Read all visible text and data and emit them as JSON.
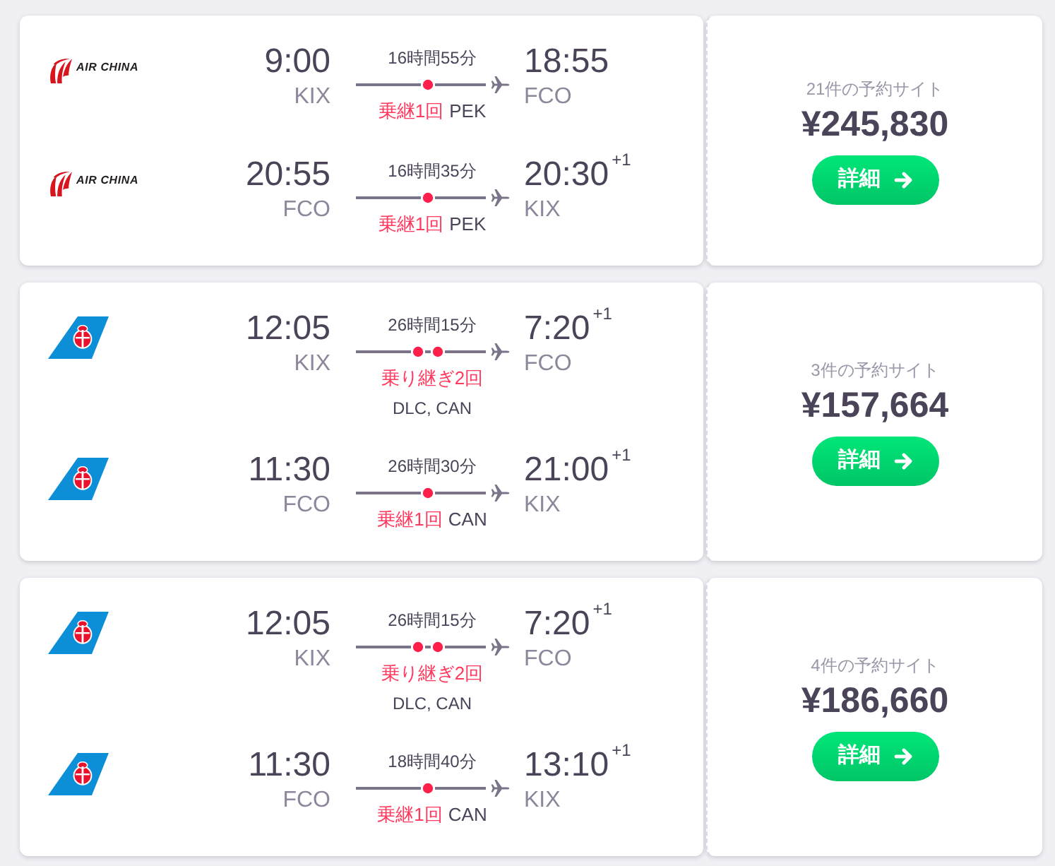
{
  "itineraries": [
    {
      "legs": [
        {
          "airline": {
            "kind": "wordmark",
            "logo_text": "AIR CHINA"
          },
          "departure": {
            "time": "9:00",
            "airport": "KIX"
          },
          "duration": "16時間55分",
          "kind": "one-stop",
          "stop_label": "乗継1回",
          "via": "PEK",
          "arrival": {
            "time": "18:55",
            "airport": "FCO"
          }
        },
        {
          "airline": {
            "kind": "wordmark",
            "logo_text": "AIR CHINA"
          },
          "departure": {
            "time": "20:55",
            "airport": "FCO"
          },
          "duration": "16時間35分",
          "kind": "one-stop",
          "stop_label": "乗継1回",
          "via": "PEK",
          "arrival": {
            "time": "20:30",
            "day_offset": "+1",
            "airport": "KIX"
          }
        }
      ],
      "offer": {
        "sites": "21件の予約サイト",
        "price": "¥245,830",
        "button": "詳細"
      }
    },
    {
      "legs": [
        {
          "airline": {
            "kind": "tailfin"
          },
          "departure": {
            "time": "12:05",
            "airport": "KIX"
          },
          "duration": "26時間15分",
          "kind": "two-stop",
          "stop_label": "乗り継ぎ2回",
          "via": "DLC, CAN",
          "arrival": {
            "time": "7:20",
            "day_offset": "+1",
            "airport": "FCO"
          }
        },
        {
          "airline": {
            "kind": "tailfin"
          },
          "departure": {
            "time": "11:30",
            "airport": "FCO"
          },
          "duration": "26時間30分",
          "kind": "one-stop",
          "stop_label": "乗継1回",
          "via": "CAN",
          "arrival": {
            "time": "21:00",
            "day_offset": "+1",
            "airport": "KIX"
          }
        }
      ],
      "offer": {
        "sites": "3件の予約サイト",
        "price": "¥157,664",
        "button": "詳細"
      }
    },
    {
      "legs": [
        {
          "airline": {
            "kind": "tailfin"
          },
          "departure": {
            "time": "12:05",
            "airport": "KIX"
          },
          "duration": "26時間15分",
          "kind": "two-stop",
          "stop_label": "乗り継ぎ2回",
          "via": "DLC, CAN",
          "arrival": {
            "time": "7:20",
            "day_offset": "+1",
            "airport": "FCO"
          }
        },
        {
          "airline": {
            "kind": "tailfin"
          },
          "departure": {
            "time": "11:30",
            "airport": "FCO"
          },
          "duration": "18時間40分",
          "kind": "one-stop",
          "stop_label": "乗継1回",
          "via": "CAN",
          "arrival": {
            "time": "13:10",
            "day_offset": "+1",
            "airport": "KIX"
          }
        }
      ],
      "offer": {
        "sites": "4件の予約サイト",
        "price": "¥186,660",
        "button": "詳細"
      }
    }
  ]
}
